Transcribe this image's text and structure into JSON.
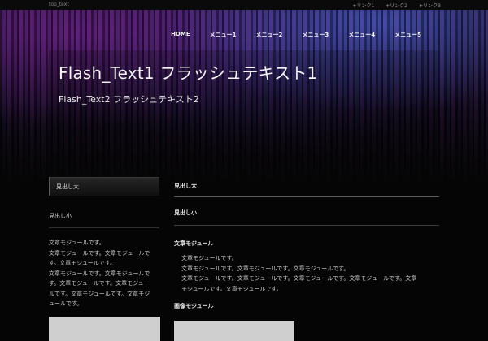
{
  "topbar": {
    "text": "top_text",
    "links": [
      "+リンク1",
      "+リンク2",
      "+リンク3"
    ]
  },
  "nav": {
    "items": [
      "HOME",
      "メニュー1",
      "メニュー2",
      "メニュー3",
      "メニュー4",
      "メニュー5"
    ]
  },
  "hero": {
    "flash_text1": "Flash_Text1 フラッシュテキスト1",
    "flash_text2": "Flash_Text2 フラッシュテキスト2"
  },
  "sidebar": {
    "heading_large": "見出し大",
    "heading_small": "見出し小",
    "text_lines": [
      "文章モジュールです。",
      "文章モジュールです。文章モジュールで",
      "す。文章モジュールです。",
      "文章モジュールです。文章モジュールで",
      "す。文章モジュールです。文章モジュー",
      "ルです。文章モジュールです。文章モジ",
      "ュールです。"
    ]
  },
  "main": {
    "heading_large": "見出し大",
    "heading_small": "見出し小",
    "text_module_title": "文章モジュール",
    "text_lines": [
      "文章モジュールです。",
      "文章モジュールです。文章モジュールです。文章モジュールです。",
      "文章モジュールです。文章モジュールです。文章モジュールです。文章モジュールです。文章",
      "モジュールです。文章モジュールです。"
    ],
    "image_module_title": "画像モジュール"
  },
  "colors": {
    "background": "#050505",
    "hero_purple": "#1a0f2e",
    "hero_accent_blue": "#5078ff",
    "hero_accent_magenta": "#aa28c8",
    "image_placeholder": "#cfcfcf"
  }
}
